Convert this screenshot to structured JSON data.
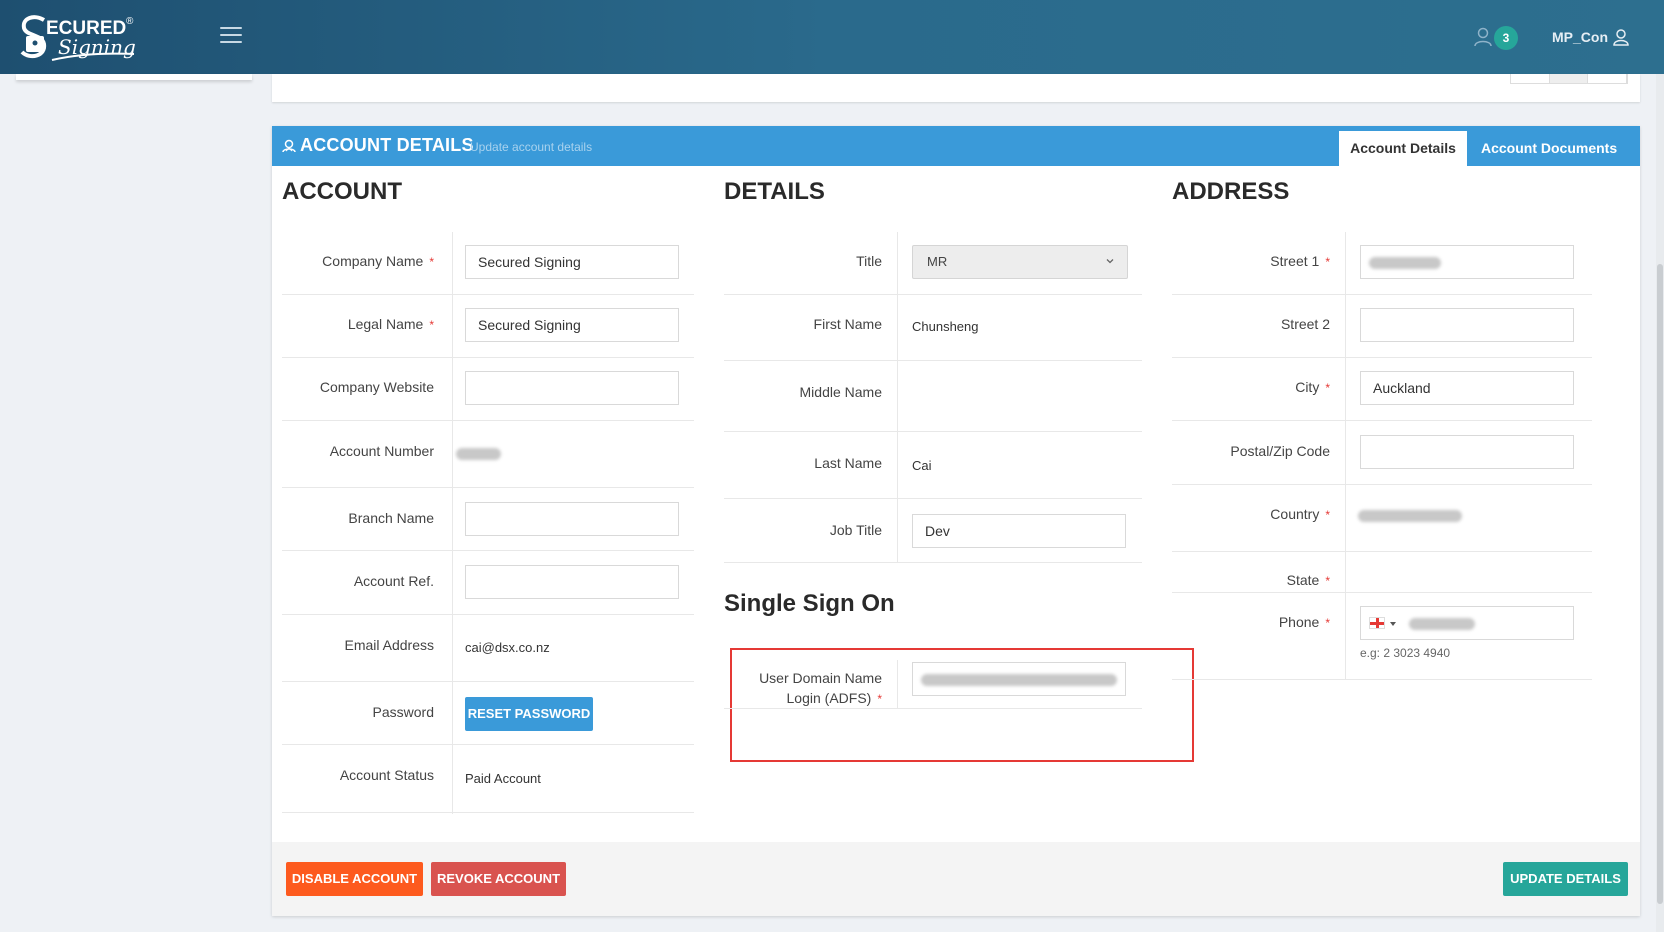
{
  "brand": {
    "logo_text_top": "ECURED",
    "logo_text_script": "Signing",
    "logo_mark": "®"
  },
  "topbar": {
    "notification_count": "3",
    "username": "MP_Con"
  },
  "header": {
    "title": "ACCOUNT DETAILS",
    "subtitle": "Update account details",
    "tabs": [
      {
        "label": "Account Details",
        "active": true
      },
      {
        "label": "Account Documents",
        "active": false
      }
    ]
  },
  "account": {
    "title": "ACCOUNT",
    "company_name_label": "Company Name",
    "company_name_value": "Secured Signing",
    "legal_name_label": "Legal Name",
    "legal_name_value": "Secured Signing",
    "company_website_label": "Company Website",
    "company_website_value": "",
    "account_number_label": "Account Number",
    "branch_name_label": "Branch Name",
    "branch_name_value": "",
    "account_ref_label": "Account Ref.",
    "account_ref_value": "",
    "email_label": "Email Address",
    "email_value": "cai@dsx.co.nz",
    "password_label": "Password",
    "reset_password_label": "RESET PASSWORD",
    "account_status_label": "Account Status",
    "account_status_value": "Paid Account"
  },
  "details": {
    "title": "DETAILS",
    "title_label": "Title",
    "title_value": "MR",
    "first_name_label": "First Name",
    "first_name_value": "Chunsheng",
    "middle_name_label": "Middle Name",
    "middle_name_value": "",
    "last_name_label": "Last Name",
    "last_name_value": "Cai",
    "job_title_label": "Job Title",
    "job_title_value": "Dev"
  },
  "sso": {
    "title": "Single Sign On",
    "label_line1": "User Domain Name",
    "label_line2": "Login (ADFS)"
  },
  "address": {
    "title": "ADDRESS",
    "street1_label": "Street 1",
    "street2_label": "Street 2",
    "street2_value": "",
    "city_label": "City",
    "city_value": "Auckland",
    "postal_label": "Postal/Zip Code",
    "postal_value": "",
    "country_label": "Country",
    "state_label": "State",
    "phone_label": "Phone",
    "phone_hint": "e.g: 2 3023 4940"
  },
  "footer": {
    "disable_label": "DISABLE ACCOUNT",
    "revoke_label": "REVOKE ACCOUNT",
    "update_label": "UPDATE DETAILS"
  },
  "required_marker": "*",
  "colors": {
    "topbar": "#2a6a8c",
    "header_blue": "#3a9ad9",
    "disable_orange": "#fd5a1e",
    "revoke_red": "#d9534f",
    "update_teal": "#26a69a",
    "highlight_red": "#e53935"
  },
  "icons": {
    "menu": "hamburger-icon",
    "notifications": "users-icon",
    "user": "user-icon",
    "header": "account-icon",
    "dropdown": "chevron-down-icon",
    "flag": "england-flag-icon"
  }
}
